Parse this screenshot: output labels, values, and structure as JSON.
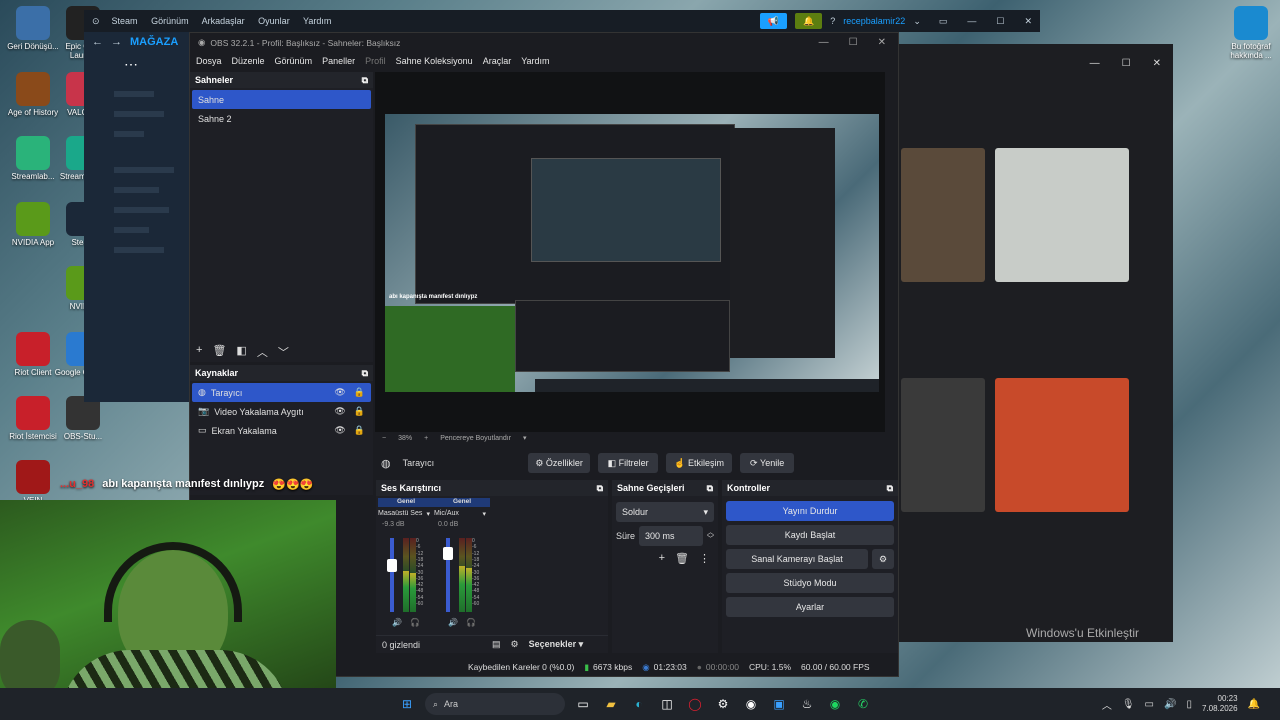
{
  "desktop": {
    "icons": [
      {
        "label": "Geri Dönüşü...",
        "color": "#3b6fa8"
      },
      {
        "label": "Epic Gam Launch",
        "color": "#222"
      },
      {
        "label": "Age of History",
        "color": "#8a4a1a"
      },
      {
        "label": "VALORA",
        "color": "#c8344a"
      },
      {
        "label": "Streamlab...",
        "color": "#2ab37a"
      },
      {
        "label": "Stream Desk",
        "color": "#1aa88a"
      },
      {
        "label": "NVIDIA App",
        "color": "#5a9a1a"
      },
      {
        "label": "Steam",
        "color": "#1b2838"
      },
      {
        "label": "NVIDIA",
        "color": "#5a9a1a"
      },
      {
        "label": "Riot Client",
        "color": "#c8202a"
      },
      {
        "label": "Google Chrome",
        "color": "#2a7ad0"
      },
      {
        "label": "Riot İstemcisi",
        "color": "#c8202a"
      },
      {
        "label": "OBS-Stu...",
        "color": "#333"
      },
      {
        "label": "VEIN",
        "color": "#a01818"
      },
      {
        "label": "Bu fotoğraf hakkında ...",
        "color": "#1a8ad0"
      }
    ],
    "windows_activate": "Windows'u Etkinleştir"
  },
  "steam": {
    "menu": [
      "Steam",
      "Görünüm",
      "Arkadaşlar",
      "Oyunlar",
      "Yardım"
    ],
    "store_label": "MAĞAZA",
    "user": "recepbalamir22",
    "help": "?"
  },
  "obs": {
    "title": "OBS 32.2.1 - Profil: Başlıksız - Sahneler: Başlıksız",
    "menu": [
      "Dosya",
      "Düzenle",
      "Görünüm",
      "Paneller",
      "Profil",
      "Sahne Koleksiyonu",
      "Araçlar",
      "Yardım"
    ],
    "scenes": {
      "header": "Sahneler",
      "items": [
        "Sahne",
        "Sahne 2"
      ]
    },
    "sources": {
      "header": "Kaynaklar",
      "items": [
        "Tarayıcı",
        "Video Yakalama Aygıtı",
        "Ekran Yakalama"
      ]
    },
    "preview": {
      "zoom": "38%",
      "fit": "Pencereye Boyutlandır"
    },
    "source_toolbar": {
      "selected": "Tarayıcı",
      "properties": "Özellikler",
      "filters": "Filtreler",
      "interact": "Etkileşim",
      "refresh": "Yenile"
    },
    "mixer": {
      "header": "Ses Karıştırıcı",
      "channels": [
        {
          "group": "Genel",
          "name": "Masaüstü Ses",
          "db": "-9.3 dB",
          "level": 0.55,
          "fader": 0.72
        },
        {
          "group": "Genel",
          "name": "Mic/Aux",
          "db": "0.0 dB",
          "level": 0.62,
          "fader": 0.88
        }
      ],
      "scale": [
        "0",
        "-6",
        "-12",
        "-18",
        "-24",
        "-30",
        "-36",
        "-42",
        "-48",
        "-54",
        "-60"
      ],
      "hidden": "0 gizlendi",
      "options": "Seçenekler"
    },
    "transitions": {
      "header": "Sahne Geçişleri",
      "type": "Soldur",
      "duration_label": "Süre",
      "duration": "300 ms"
    },
    "controls": {
      "header": "Kontroller",
      "buttons": [
        "Yayını Durdur",
        "Kaydı Başlat",
        "Sanal Kamerayı Başlat",
        "Stüdyo Modu",
        "Ayarlar"
      ]
    },
    "status": {
      "dropped": "Kaybedilen Kareler 0 (%0.0)",
      "bitrate": "6673 kbps",
      "stream_time": "01:23:03",
      "rec_time": "00:00:00",
      "cpu": "CPU: 1.5%",
      "fps": "60.00 / 60.00 FPS"
    }
  },
  "chat": {
    "user": "...u_98",
    "message": "abı kapanışta manıfest dınlıypz"
  },
  "taskbar": {
    "search": "Ara",
    "time": "00:23",
    "date": "7.08.2026"
  }
}
